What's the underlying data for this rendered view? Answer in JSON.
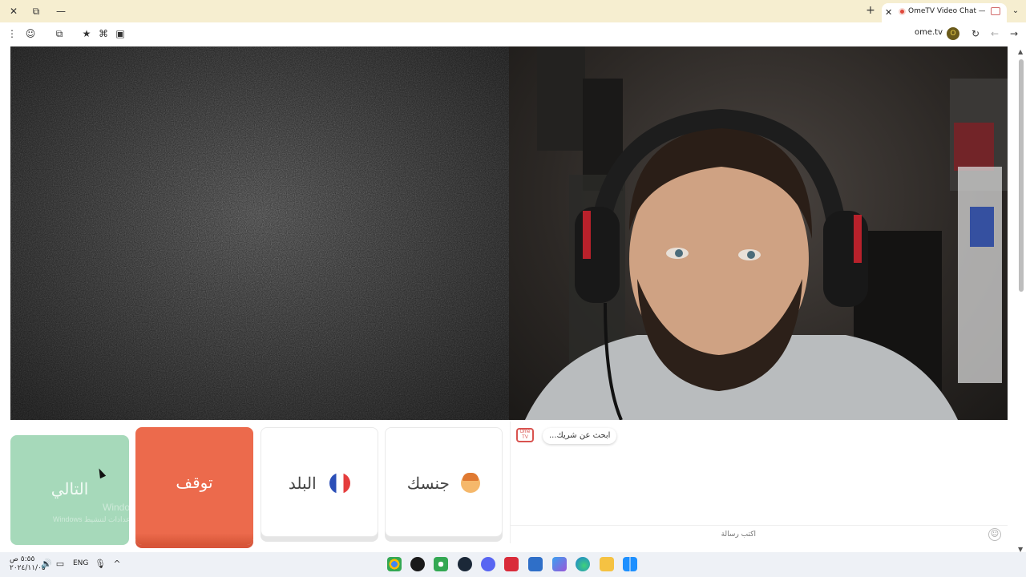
{
  "browser": {
    "tab_title": "OmeTV Video Chat — Omegle",
    "tab_close": "✕",
    "new_tab": "+",
    "tab_menu": "⌄",
    "window_close": "✕",
    "window_restore": "⧉",
    "window_minimize": "—",
    "url": "ome.tv",
    "site_badge": "O"
  },
  "toolbar_icons": [
    "menu-icon",
    "profile-icon",
    "extensions-icon",
    "bookmark-star-icon",
    "translate-icon",
    "screen-cast-icon",
    "reload-icon",
    "back-icon",
    "forward-icon"
  ],
  "controls": {
    "next_label": "التالي",
    "stop_label": "توقف",
    "country_label": "البلد",
    "gender_label": "جنسك"
  },
  "watermark": {
    "line1": "Windows تنشيط",
    "line2": "Windows انتقل إلى الإعدادات لتنشيط"
  },
  "chat": {
    "logo": "Ome TV",
    "status_message": "...ابحث عن شريك",
    "input_placeholder": "اكتب رسالة",
    "emoji": "☺"
  },
  "taskbar": {
    "time": "٥:٥٥ ص",
    "date": "٢٠٢٤/١١/٠٥",
    "language": "ENG"
  },
  "colors": {
    "next": "#a6d9ba",
    "stop": "#ec6a4c",
    "titlebar": "#f6eed0"
  }
}
